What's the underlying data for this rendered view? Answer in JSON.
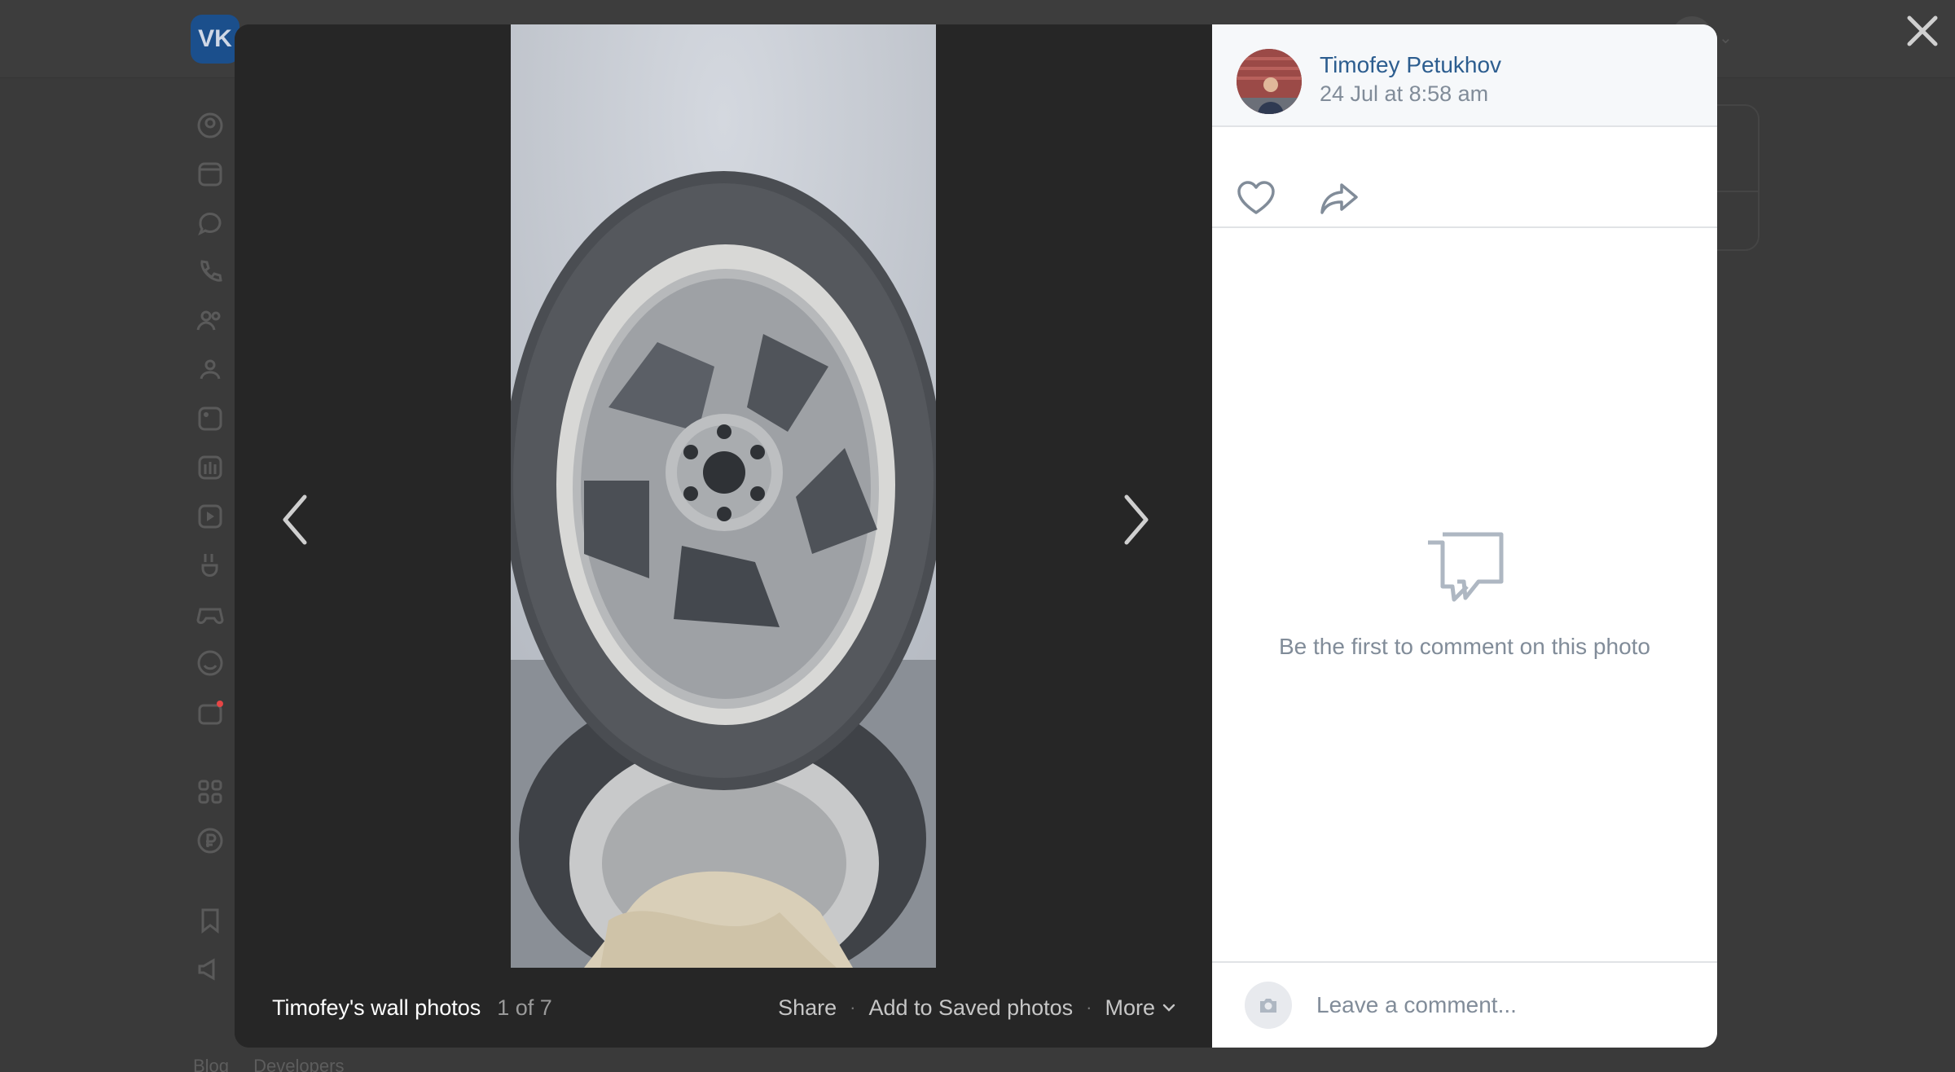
{
  "viewer": {
    "album_title": "Timofey's wall photos",
    "counter": "1 of 7",
    "actions": {
      "share": "Share",
      "save": "Add to Saved photos",
      "more": "More"
    }
  },
  "post": {
    "author": "Timofey Petukhov",
    "date": "24 Jul at 8:58 am"
  },
  "comments": {
    "empty_text": "Be the first to comment on this photo",
    "placeholder": "Leave a comment..."
  },
  "background": {
    "logo": "VK",
    "footer_links": [
      "Blog",
      "Developers"
    ],
    "sidebar_icons": [
      "profile-icon",
      "news-icon",
      "messages-icon",
      "calls-icon",
      "friends-icon",
      "communities-icon",
      "photos-icon",
      "music-icon",
      "video-icon",
      "clips-icon",
      "games-icon",
      "stickers-icon",
      "gifts-icon",
      "apps-icon",
      "payments-icon",
      "bookmarks-icon",
      "ads-icon"
    ]
  }
}
